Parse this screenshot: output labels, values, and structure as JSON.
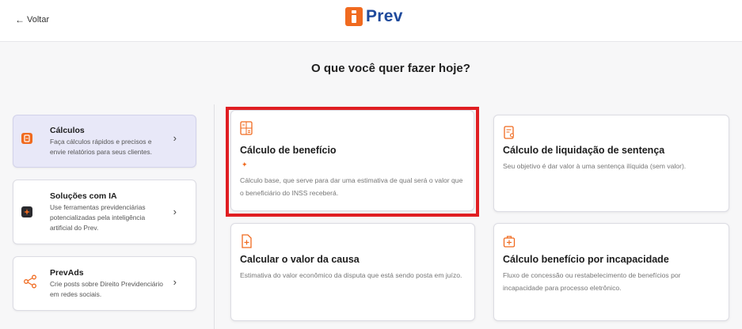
{
  "header": {
    "back_label": "Voltar",
    "logo_text": "Prev"
  },
  "heading": "O que você quer fazer hoje?",
  "sidebar": {
    "items": [
      {
        "title": "Cálculos",
        "desc": "Faça cálculos rápidos e precisos e envie relatórios para seus clientes."
      },
      {
        "title": "Soluções com IA",
        "desc": "Use ferramentas previdenciárias potencializadas pela inteligência artificial do Prev."
      },
      {
        "title": "PrevAds",
        "desc": "Crie posts sobre Direito Previdenciário em redes sociais."
      }
    ],
    "chevron": "›"
  },
  "options": [
    {
      "title": "Cálculo de benefício",
      "desc": "Cálculo base, que serve para dar uma estimativa de qual será o valor que o beneficiário do INSS receberá."
    },
    {
      "title": "Cálculo de liquidação de sentença",
      "desc": "Seu objetivo é dar valor à uma sentença ilíquida (sem valor)."
    },
    {
      "title": "Calcular o valor da causa",
      "desc": "Estimativa do valor econômico da disputa que está sendo posta em juízo."
    },
    {
      "title": "Cálculo benefício por incapacidade",
      "desc": "Fluxo de concessão ou restabelecimento de benefícios por incapacidade para processo eletrônico."
    }
  ],
  "colors": {
    "accent": "#f06a1f",
    "brand_blue": "#1f4a9c",
    "active_bg": "#e8e8f8",
    "highlight": "#e01e22"
  },
  "icons": {
    "back": "arrow-left-icon",
    "calculos": "calculator-icon",
    "ia": "sparkle-icon",
    "prevads": "share-icon",
    "beneficio": "calculator-icon",
    "liquidacao": "document-person-icon",
    "causa": "document-plus-icon",
    "incapacidade": "medical-kit-icon"
  }
}
